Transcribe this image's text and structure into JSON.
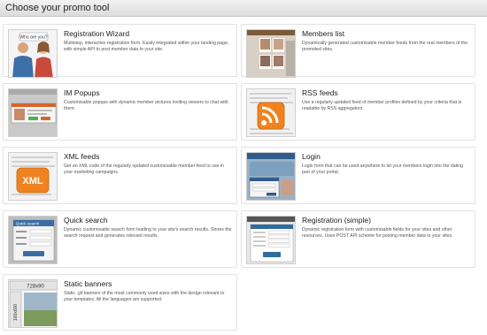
{
  "header": {
    "title": "Choose your promo tool"
  },
  "cards": [
    {
      "title": "Registration Wizard",
      "desc": "Multistep, interactive registration form. Easily integrated within your landing page, with simple API to post member data to your site.",
      "thumb": "registration-wizard-thumbnail",
      "thumb_text": "Who are you?"
    },
    {
      "title": "Members list",
      "desc": "Dynamically generated customisable member feeds from the real members of the promoted sites.",
      "thumb": "members-list-thumbnail"
    },
    {
      "title": "IM Popups",
      "desc": "Customisable popups with dynamic member pictures inviting viewers to chat with them.",
      "thumb": "im-popups-thumbnail"
    },
    {
      "title": "RSS feeds",
      "desc": "Use a regularly updated feed of member profiles defined by your criteria that is readable by RSS aggregators.",
      "thumb": "rss-feeds-thumbnail"
    },
    {
      "title": "XML feeds",
      "desc": "Get an XML code of the regularly updated customisable member feed to use in your marketing campaigns.",
      "thumb": "xml-feeds-thumbnail",
      "thumb_text": "XML"
    },
    {
      "title": "Login",
      "desc": "Login form that can be used anywhere to let your members login into the dating part of your portal.",
      "thumb": "login-thumbnail"
    },
    {
      "title": "Quick search",
      "desc": "Dynamic customisable search form leading to your site's search results. Stores the search request and generates relevant results.",
      "thumb": "quick-search-thumbnail",
      "thumb_text": "Quick search"
    },
    {
      "title": "Registration (simple)",
      "desc": "Dynamic registration form with customisable fields for your sites and other resources. Uses POST API scheme for posting member data to your sites.",
      "thumb": "registration-simple-thumbnail"
    },
    {
      "title": "Static banners",
      "desc": "Static .gif banners of the most commonly used sizes with the design relevant to your templates. All the languages are supported.",
      "thumb": "static-banners-thumbnail",
      "thumb_text": "728x90",
      "thumb_text2": "160x600"
    }
  ]
}
